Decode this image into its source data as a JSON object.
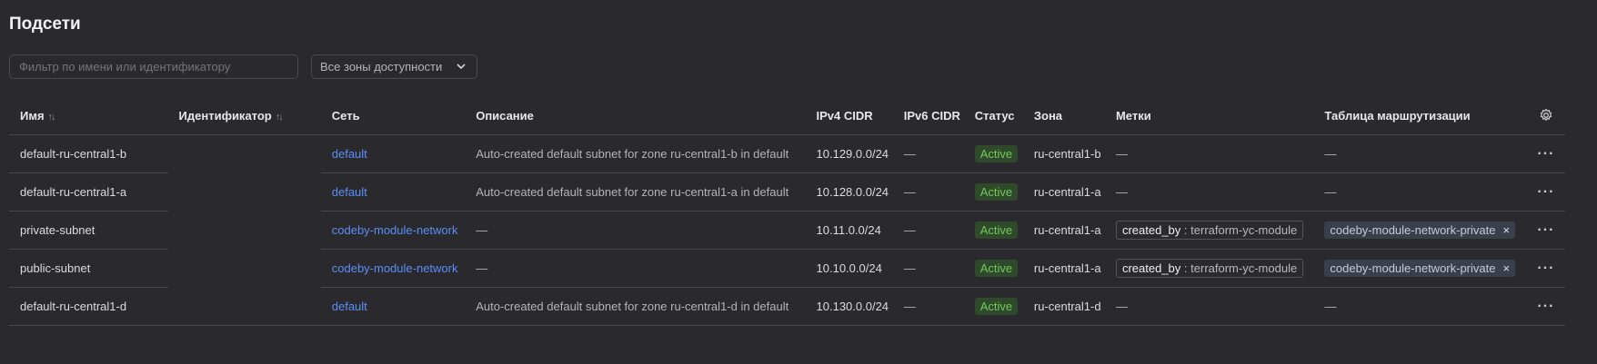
{
  "page": {
    "title": "Подсети"
  },
  "filter": {
    "placeholder": "Фильтр по имени или идентификатору"
  },
  "zone_select": {
    "value": "Все зоны доступности"
  },
  "table": {
    "headers": {
      "name": "Имя",
      "id": "Идентификатор",
      "network": "Сеть",
      "description": "Описание",
      "ipv4": "IPv4 CIDR",
      "ipv6": "IPv6 CIDR",
      "status": "Статус",
      "zone": "Зона",
      "labels": "Метки",
      "route_table": "Таблица маршрутизации"
    },
    "rows": [
      {
        "name": "default-ru-central1-b",
        "network": "default",
        "description": "Auto-created default subnet for zone ru-central1-b in default",
        "ipv4": "10.129.0.0/24",
        "ipv6": "—",
        "status": "Active",
        "zone": "ru-central1-b",
        "labels": "—",
        "route_table": "—"
      },
      {
        "name": "default-ru-central1-a",
        "network": "default",
        "description": "Auto-created default subnet for zone ru-central1-a in default",
        "ipv4": "10.128.0.0/24",
        "ipv6": "—",
        "status": "Active",
        "zone": "ru-central1-a",
        "labels": "—",
        "route_table": "—"
      },
      {
        "name": "private-subnet",
        "network": "codeby-module-network",
        "description": "—",
        "ipv4": "10.11.0.0/24",
        "ipv6": "—",
        "status": "Active",
        "zone": "ru-central1-a",
        "label_key": "created_by",
        "label_sep": ":",
        "label_value": "terraform-yc-module",
        "route_table": "codeby-module-network-private"
      },
      {
        "name": "public-subnet",
        "network": "codeby-module-network",
        "description": "—",
        "ipv4": "10.10.0.0/24",
        "ipv6": "—",
        "status": "Active",
        "zone": "ru-central1-a",
        "label_key": "created_by",
        "label_sep": ":",
        "label_value": "terraform-yc-module",
        "route_table": "codeby-module-network-private"
      },
      {
        "name": "default-ru-central1-d",
        "network": "default",
        "description": "Auto-created default subnet for zone ru-central1-d in default",
        "ipv4": "10.130.0.0/24",
        "ipv6": "—",
        "status": "Active",
        "zone": "ru-central1-d",
        "labels": "—",
        "route_table": "—"
      }
    ],
    "remove_symbol": "×",
    "menu_symbol": "···"
  },
  "icons": {
    "sort": "sort-icon",
    "chevron": "chevron-down-icon",
    "settings": "gear-icon",
    "more": "more-icon"
  },
  "colors": {
    "background": "#2a292e",
    "link": "#5b8ff5",
    "status_bg": "#2e4a2a",
    "status_text": "#72c85c",
    "route_bg": "#3a3f4c"
  }
}
